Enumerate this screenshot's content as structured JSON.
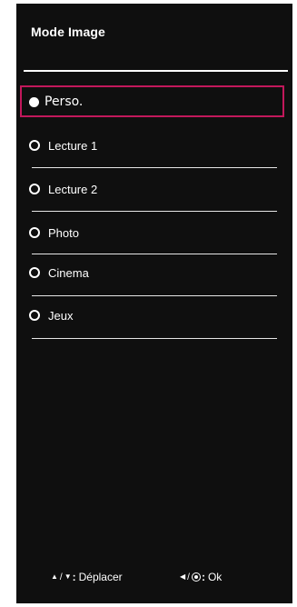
{
  "header": {
    "title": "Mode Image"
  },
  "menu": {
    "items": [
      {
        "label": "Perso.",
        "selected": true
      },
      {
        "label": "Lecture 1",
        "selected": false
      },
      {
        "label": "Lecture 2",
        "selected": false
      },
      {
        "label": "Photo",
        "selected": false
      },
      {
        "label": "Cinema",
        "selected": false
      },
      {
        "label": "Jeux",
        "selected": false
      }
    ]
  },
  "footer": {
    "move_up_icon": "▲",
    "move_separator": "/",
    "move_down_icon": "▼",
    "move_label": "Déplacer",
    "ok_left_icon": "◀",
    "ok_separator": "/",
    "ok_label": "Ok"
  },
  "colors": {
    "background": "#0f0f0f",
    "text": "#ffffff",
    "selection_border": "#c2185b",
    "divider": "#e6e6e6"
  },
  "icons": {
    "selected_item": "radio-filled-icon",
    "unselected_item": "radio-ring-icon",
    "move_up": "triangle-up-icon",
    "move_down": "triangle-down-icon",
    "back": "triangle-left-icon",
    "ok": "ok-button-icon"
  }
}
